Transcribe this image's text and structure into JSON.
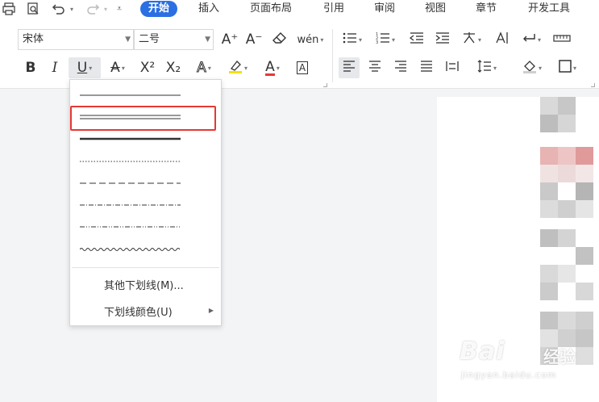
{
  "menubar": {
    "tabs": [
      "开始",
      "插入",
      "页面布局",
      "引用",
      "审阅",
      "视图",
      "章节",
      "开发工具"
    ],
    "active_tab": "开始",
    "accent_color": "#2b6fe3"
  },
  "ribbon": {
    "font_name": "宋体",
    "font_size": "二号",
    "bold_label": "B",
    "italic_label": "I",
    "underline_label": "U",
    "strike_label": "A",
    "superscript_label": "X²",
    "subscript_label": "X₂",
    "effect_label": "A",
    "font_color_label": "A",
    "char_border_label": "A",
    "grow_font_label": "A⁺",
    "shrink_font_label": "A⁻",
    "phonetic_label": "wén"
  },
  "underline_menu": {
    "styles": [
      "single",
      "double",
      "thick",
      "dotted",
      "dashed",
      "dash-dot",
      "dash-dot-dot",
      "wavy"
    ],
    "highlighted_style": "double",
    "highlight_color": "#e53935",
    "more_label": "其他下划线(M)...",
    "color_label": "下划线颜色(U)"
  },
  "watermark": {
    "brand": "Bai",
    "suffix": "经验",
    "url": "jingyan.baidu.com"
  }
}
